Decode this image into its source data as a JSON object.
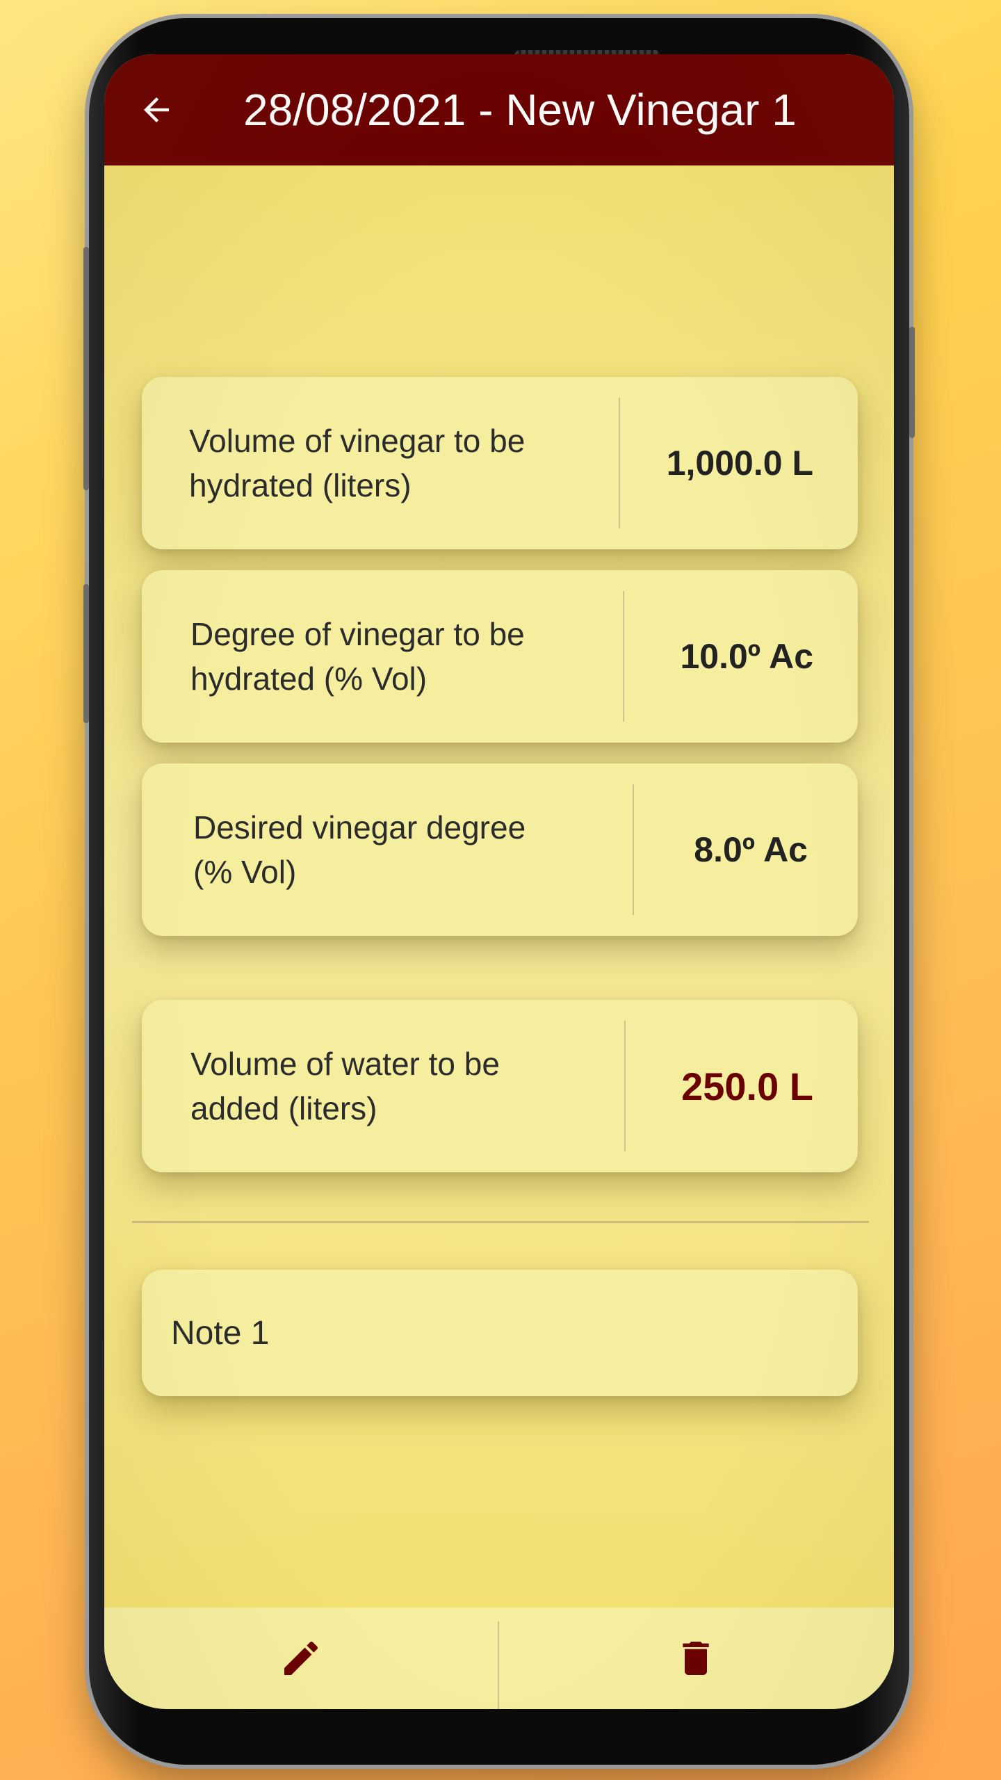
{
  "appbar": {
    "title": "28/08/2021 - New Vinegar 1",
    "back_icon": "arrow-left-icon",
    "color": "#6a0000"
  },
  "fields": [
    {
      "label_line1": "Volume of vinegar to be",
      "label_line2": "hydrated (liters)",
      "value": "1,000.0 L"
    },
    {
      "label_line1": "Degree of vinegar to be",
      "label_line2": "hydrated (% Vol)",
      "value": "10.0º Ac"
    },
    {
      "label_line1": "Desired vinegar degree",
      "label_line2": "(% Vol)",
      "value": "8.0º Ac"
    }
  ],
  "result": {
    "label_line1": "Volume of water to be",
    "label_line2": "added (liters)",
    "value": "250.0 L",
    "color": "#6a0000"
  },
  "note": {
    "text": "Note 1"
  },
  "bottombar": {
    "edit_icon": "pencil-icon",
    "delete_icon": "trash-icon"
  },
  "colors": {
    "background": "#f2df6c",
    "card": "#f5ee9f",
    "accent": "#6a0000"
  }
}
